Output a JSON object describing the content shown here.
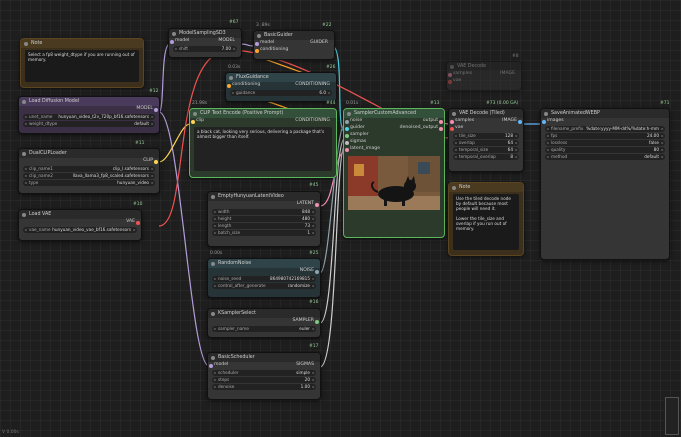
{
  "colors": {
    "model": "#b39ddb",
    "clip": "#ffd54f",
    "vae": "#ef5350",
    "latent": "#f48fb1",
    "conditioning": "#ffa726",
    "guider": "#4dd0e1",
    "noise": "#90a4ae",
    "sampler": "#81c784",
    "sigmas": "#bdbdbd",
    "image": "#64b5f6"
  },
  "note1": {
    "title": "Note",
    "text": "Select a fp8 weight_dtype if you are running out of memory."
  },
  "model_sampling": {
    "title": "ModelSamplingSD3",
    "badge": "#67",
    "in_model": "model",
    "out_model": "MODEL",
    "shift_label": "shift",
    "shift_value": "7.00"
  },
  "basic_guider": {
    "title": "BasicGuider",
    "badge": "#22",
    "in_model": "model",
    "in_cond": "conditioning",
    "out": "GUIDER",
    "tag": "3 .89s"
  },
  "flux_guidance": {
    "title": "FluxGuidance",
    "badge": "#26",
    "tag": "0.03s",
    "in": "conditioning",
    "out": "CONDITIONING",
    "w_label": "guidance",
    "w_value": "6.0"
  },
  "load_diffusion": {
    "title": "Load Diffusion Model",
    "badge": "#12",
    "out": "MODEL",
    "w1_label": "unet_name",
    "w1_value": "hunyuan_video_t2v_720p_bf16.safetensors",
    "w2_label": "weight_dtype",
    "w2_value": "default"
  },
  "clip_text": {
    "title": "CLIP Text Encode (Positive Prompt)",
    "badge": "#44",
    "tag": "21.98s",
    "in": "clip",
    "out": "CONDITIONING",
    "text": "a black cat, looking very serious, delivering a package that's almost bigger than itself."
  },
  "dual_clip": {
    "title": "DualCLIPLoader",
    "badge": "#11",
    "out": "CLIP",
    "w1_label": "clip_name1",
    "w1_value": "clip_l.safetensors",
    "w2_label": "clip_name2",
    "w2_value": "llava_llama3_fp8_scaled.safetensors",
    "w3_label": "type",
    "w3_value": "hunyuan_video"
  },
  "load_vae": {
    "title": "Load VAE",
    "badge": "#10",
    "out": "VAE",
    "w_label": "vae_name",
    "w_value": "hunyuan_video_vae_bf16.safetensors"
  },
  "empty_latent": {
    "title": "EmptyHunyuanLatentVideo",
    "badge": "#45",
    "out": "LATENT",
    "w": [
      {
        "label": "width",
        "value": "848"
      },
      {
        "label": "height",
        "value": "480"
      },
      {
        "label": "length",
        "value": "73"
      },
      {
        "label": "batch_size",
        "value": "1"
      }
    ]
  },
  "random_noise": {
    "title": "RandomNoise",
    "badge": "#25",
    "tag": "0.00s",
    "out": "NOISE",
    "w1_label": "noise_seed",
    "w1_value": "864980742169815",
    "w2_label": "control_after_generate",
    "w2_value": "randomize"
  },
  "ksampler_select": {
    "title": "KSamplerSelect",
    "badge": "#16",
    "out": "SAMPLER",
    "w_label": "sampler_name",
    "w_value": "euler"
  },
  "basic_scheduler": {
    "title": "BasicScheduler",
    "badge": "#17",
    "in": "model",
    "out": "SIGMAS",
    "w": [
      {
        "label": "scheduler",
        "value": "simple"
      },
      {
        "label": "steps",
        "value": "20"
      },
      {
        "label": "denoise",
        "value": "1.00"
      }
    ]
  },
  "sampler_adv": {
    "title": "SamplerCustomAdvanced",
    "badge": "#13",
    "tag": "0.01s",
    "inputs": [
      "noise",
      "guider",
      "sampler",
      "sigmas",
      "latent_image"
    ],
    "out1": "output",
    "out2": "denoised_output"
  },
  "vae_tile": {
    "title": "VAE Decode (Tiled)",
    "badge": "#73 (0.00 GA)",
    "in1": "samples",
    "in2": "vae",
    "out": "IMAGE",
    "w": [
      {
        "label": "tile_size",
        "value": "128"
      },
      {
        "label": "overlap",
        "value": "64"
      },
      {
        "label": "temporal_size",
        "value": "64"
      },
      {
        "label": "temporal_overlap",
        "value": "8"
      }
    ]
  },
  "vae_decode_dim": {
    "title": "VAE Decode",
    "badge": "#8",
    "in1": "samples",
    "in2": "vae",
    "out": "IMAGE"
  },
  "note2": {
    "title": "Note",
    "text": "Use the tiled decode node by default because most people will need it.\n\nLower the tile_size and overlap if you run out of memory."
  },
  "save_webp": {
    "title": "SaveAnimatedWEBP",
    "badge": "#71",
    "in": "images",
    "w": [
      {
        "label": "filename_prefix",
        "value": "%date:yyyy-MM-dd%/%date:h-mm"
      },
      {
        "label": "fps",
        "value": "24.00"
      },
      {
        "label": "lossless",
        "value": "false"
      },
      {
        "label": "quality",
        "value": "80"
      },
      {
        "label": "method",
        "value": "default"
      }
    ]
  },
  "footer": {
    "text": "V 0.00s"
  }
}
